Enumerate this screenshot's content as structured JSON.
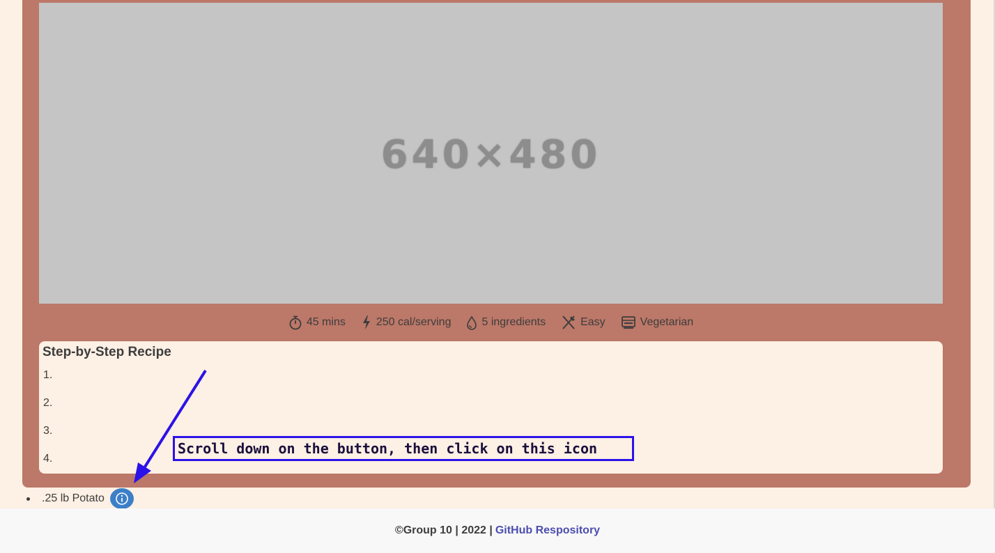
{
  "image_placeholder": {
    "text": "640×480"
  },
  "recipe_meta": {
    "time": "45 mins",
    "calories": "250 cal/serving",
    "ingredients": "5 ingredients",
    "difficulty": "Easy",
    "diet": "Vegetarian"
  },
  "steps": {
    "title": "Step-by-Step Recipe",
    "items": [
      "1.",
      "2.",
      "3.",
      "4."
    ]
  },
  "ingredient": {
    "label": ".25 lb Potato"
  },
  "annotation": {
    "text": "Scroll down on the button, then click on this icon",
    "color": "#2b12e8"
  },
  "footer": {
    "copyright": "©Group 10 | 2022 |",
    "link_label": "GitHub Respository"
  },
  "colors": {
    "card": "#bc7868",
    "background": "#fdf0e4",
    "info_button": "#3c7fc7",
    "link": "#4d4db0"
  }
}
